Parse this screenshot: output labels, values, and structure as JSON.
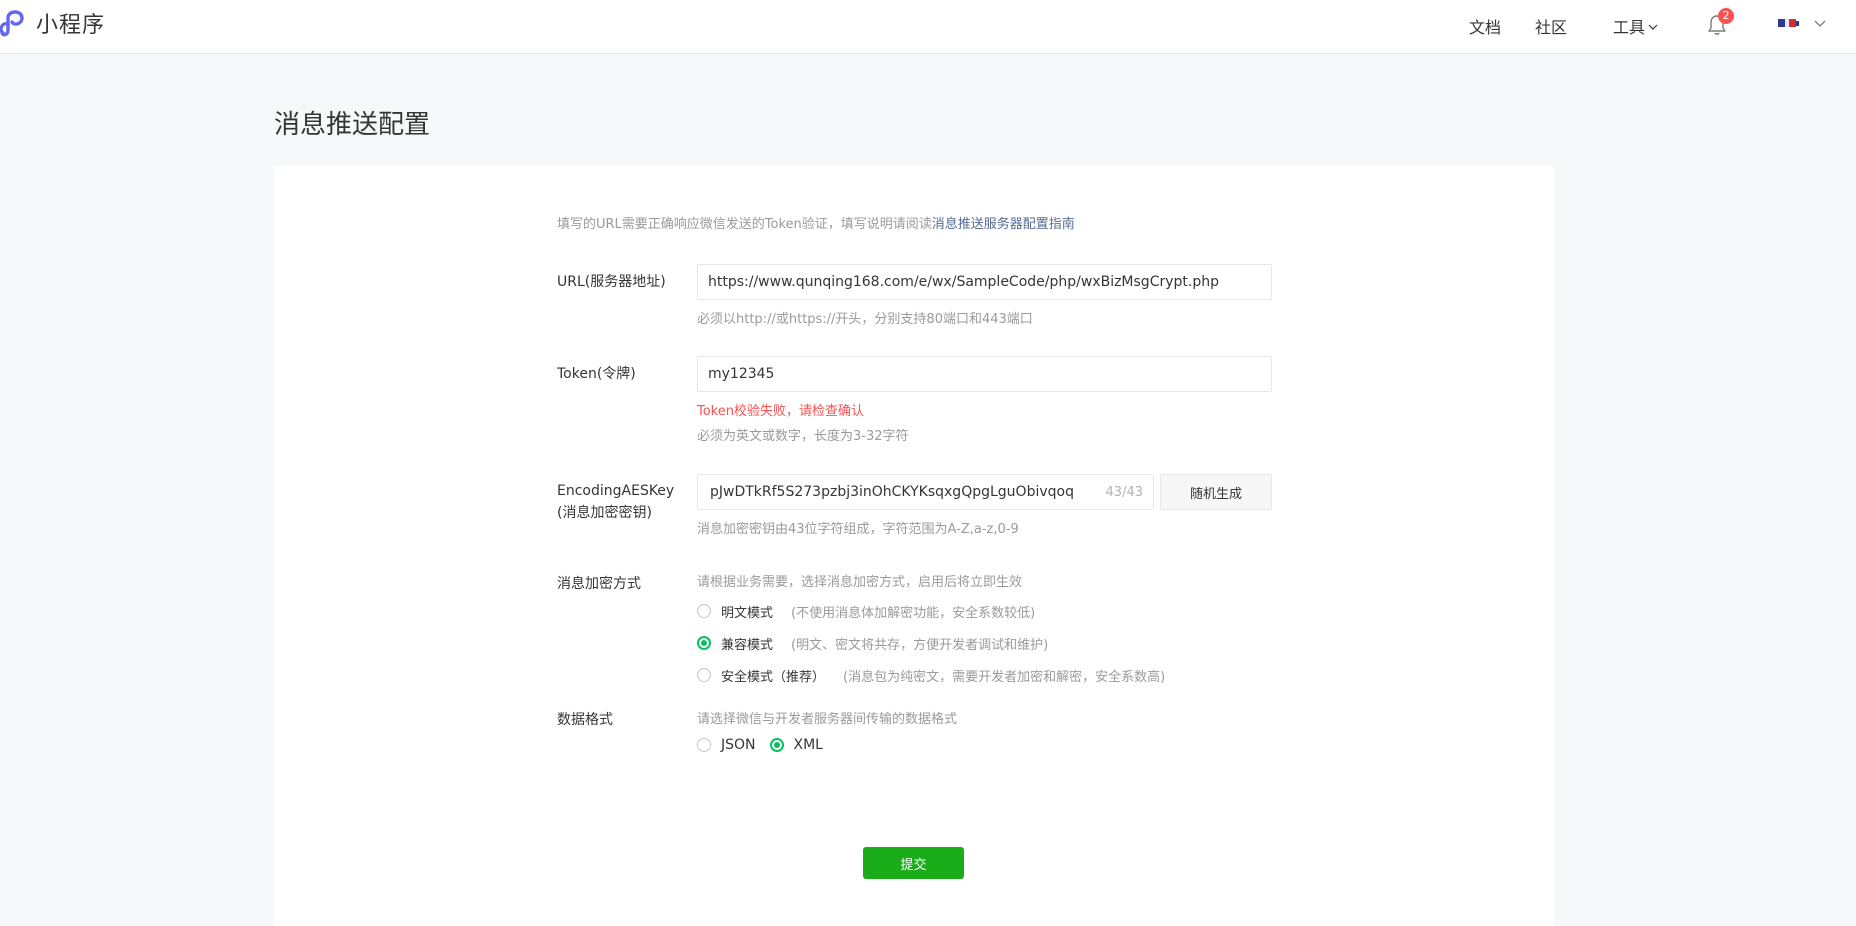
{
  "header": {
    "app_name": "小程序",
    "nav": {
      "docs": "文档",
      "community": "社区",
      "tools": "工具"
    },
    "notification_count": "2"
  },
  "page": {
    "title": "消息推送配置"
  },
  "form": {
    "intro_text": "填写的URL需要正确响应微信发送的Token验证，填写说明请阅读",
    "intro_link": "消息推送服务器配置指南",
    "url": {
      "label": "URL(服务器地址)",
      "value": "https://www.qunqing168.com/e/wx/SampleCode/php/wxBizMsgCrypt.php",
      "hint": "必须以http://或https://开头，分别支持80端口和443端口"
    },
    "token": {
      "label": "Token(令牌)",
      "value": "my12345",
      "error": "Token校验失败，请检查确认",
      "hint": "必须为英文或数字，长度为3-32字符"
    },
    "aes": {
      "label_line1": "EncodingAESKey",
      "label_line2": "(消息加密密钥)",
      "value": "pJwDTkRf5S273pzbj3inOhCKYKsqxgQpgLguObivqoq",
      "counter": "43/43",
      "generate_label": "随机生成",
      "hint": "消息加密密钥由43位字符组成，字符范围为A-Z,a-z,0-9"
    },
    "encryption": {
      "label": "消息加密方式",
      "hint": "请根据业务需要，选择消息加密方式，启用后将立即生效",
      "options": [
        {
          "label": "明文模式",
          "desc": "(不使用消息体加解密功能，安全系数较低)",
          "checked": false
        },
        {
          "label": "兼容模式",
          "desc": "(明文、密文将共存，方便开发者调试和维护)",
          "checked": true
        },
        {
          "label": "安全模式（推荐）",
          "desc": "(消息包为纯密文，需要开发者加密和解密，安全系数高)",
          "checked": false
        }
      ]
    },
    "data_format": {
      "label": "数据格式",
      "hint": "请选择微信与开发者服务器间传输的数据格式",
      "options": [
        {
          "label": "JSON",
          "checked": false
        },
        {
          "label": "XML",
          "checked": true
        }
      ]
    },
    "submit_label": "提交"
  },
  "colors": {
    "accent": "#07c160",
    "submit": "#1aad19",
    "error": "#fa5151",
    "link": "#576b95",
    "badge": "#fa5151"
  }
}
